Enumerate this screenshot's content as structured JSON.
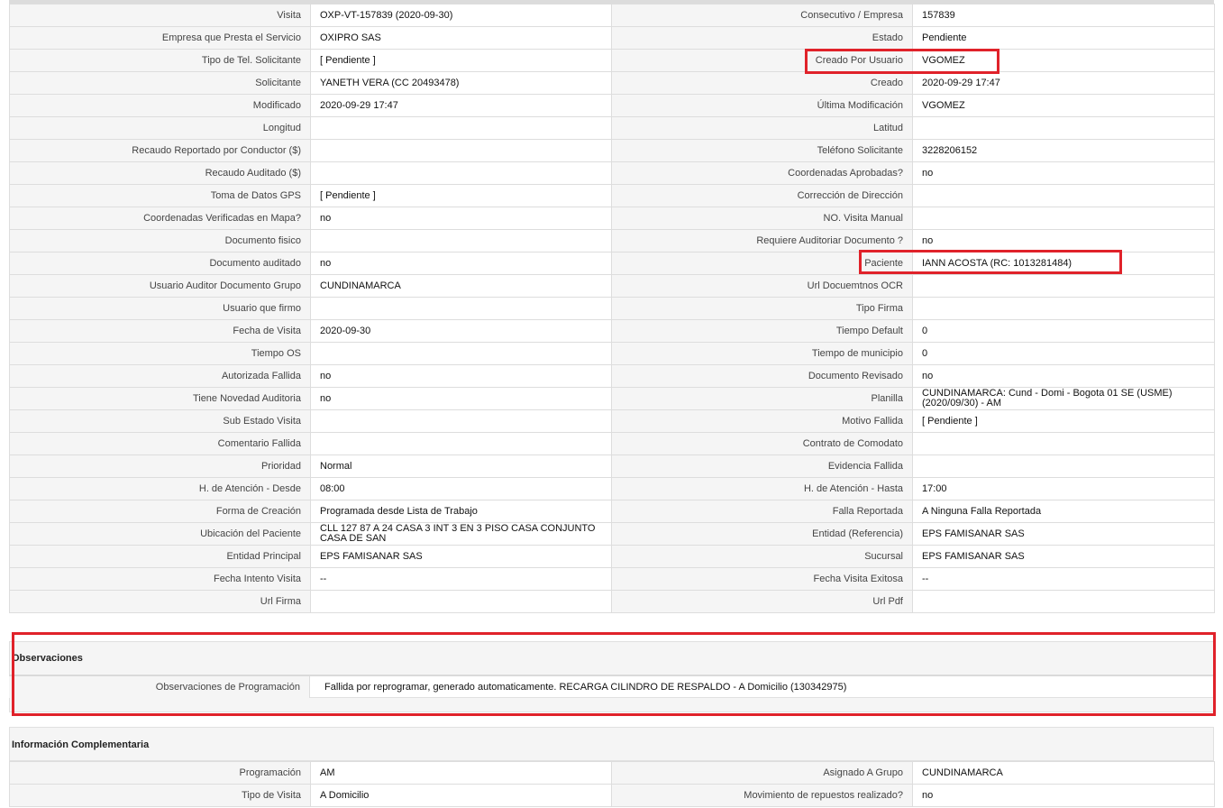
{
  "main_rows": [
    [
      {
        "l": "Visita",
        "v": "OXP-VT-157839 (2020-09-30)"
      },
      {
        "l": "Consecutivo / Empresa",
        "v": "157839"
      }
    ],
    [
      {
        "l": "Empresa que Presta el Servicio",
        "v": "OXIPRO SAS"
      },
      {
        "l": "Estado",
        "v": "Pendiente"
      }
    ],
    [
      {
        "l": "Tipo de Tel. Solicitante",
        "v": "[ Pendiente ]"
      },
      {
        "l": "Creado Por Usuario",
        "v": "VGOMEZ"
      }
    ],
    [
      {
        "l": "Solicitante",
        "v": "YANETH VERA (CC 20493478)"
      },
      {
        "l": "Creado",
        "v": "2020-09-29 17:47"
      }
    ],
    [
      {
        "l": "Modificado",
        "v": "2020-09-29 17:47"
      },
      {
        "l": "Última Modificación",
        "v": " VGOMEZ"
      }
    ],
    [
      {
        "l": "Longitud",
        "v": ""
      },
      {
        "l": "Latitud",
        "v": ""
      }
    ],
    [
      {
        "l": "Recaudo Reportado por Conductor ($)",
        "v": ""
      },
      {
        "l": "Teléfono Solicitante",
        "v": "3228206152"
      }
    ],
    [
      {
        "l": "Recaudo Auditado ($)",
        "v": ""
      },
      {
        "l": "Coordenadas Aprobadas?",
        "v": " no"
      }
    ],
    [
      {
        "l": "Toma de Datos GPS",
        "v": "[ Pendiente ]"
      },
      {
        "l": "Corrección de Dirección",
        "v": ""
      }
    ],
    [
      {
        "l": "Coordenadas Verificadas en Mapa?",
        "v": " no"
      },
      {
        "l": "NO. Visita Manual",
        "v": ""
      }
    ],
    [
      {
        "l": "Documento fisico",
        "v": ""
      },
      {
        "l": "Requiere Auditoriar Documento ?",
        "v": " no"
      }
    ],
    [
      {
        "l": "Documento auditado",
        "v": " no"
      },
      {
        "l": "Paciente",
        "v": "IANN ACOSTA (RC: 1013281484)"
      }
    ],
    [
      {
        "l": "Usuario Auditor Documento Grupo",
        "v": "CUNDINAMARCA"
      },
      {
        "l": "Url Docuemtnos OCR",
        "v": ""
      }
    ],
    [
      {
        "l": "Usuario que firmo",
        "v": ""
      },
      {
        "l": "Tipo Firma",
        "v": ""
      }
    ],
    [
      {
        "l": "Fecha de Visita",
        "v": " 2020-09-30"
      },
      {
        "l": "Tiempo Default",
        "v": " 0"
      }
    ],
    [
      {
        "l": "Tiempo OS",
        "v": ""
      },
      {
        "l": "Tiempo de municipio",
        "v": " 0"
      }
    ],
    [
      {
        "l": "Autorizada Fallida",
        "v": " no"
      },
      {
        "l": "Documento Revisado",
        "v": " no"
      }
    ],
    [
      {
        "l": "Tiene Novedad Auditoria",
        "v": " no"
      },
      {
        "l": "Planilla",
        "v": "CUNDINAMARCA: Cund - Domi - Bogota 01 SE (USME) (2020/09/30) - AM"
      }
    ],
    [
      {
        "l": "Sub Estado Visita",
        "v": ""
      },
      {
        "l": "Motivo Fallida",
        "v": "[ Pendiente ]"
      }
    ],
    [
      {
        "l": "Comentario Fallida",
        "v": ""
      },
      {
        "l": "Contrato de Comodato",
        "v": ""
      }
    ],
    [
      {
        "l": "Prioridad",
        "v": "Normal"
      },
      {
        "l": "Evidencia Fallida",
        "v": ""
      }
    ],
    [
      {
        "l": "H. de Atención - Desde",
        "v": "08:00"
      },
      {
        "l": "H. de Atención - Hasta",
        "v": "17:00"
      }
    ],
    [
      {
        "l": "Forma de Creación",
        "v": "Programada desde Lista de Trabajo"
      },
      {
        "l": "Falla Reportada",
        "v": "A Ninguna Falla Reportada"
      }
    ],
    [
      {
        "l": "Ubicación del Paciente",
        "v": "CLL 127 87 A 24 CASA 3 INT 3 EN 3 PISO CASA CONJUNTO CASA DE SAN"
      },
      {
        "l": "Entidad (Referencia)",
        "v": "EPS FAMISANAR SAS"
      }
    ],
    [
      {
        "l": "Entidad Principal",
        "v": "EPS FAMISANAR SAS"
      },
      {
        "l": "Sucursal",
        "v": "EPS FAMISANAR SAS"
      }
    ],
    [
      {
        "l": "Fecha Intento Visita",
        "v": " --"
      },
      {
        "l": "Fecha Visita Exitosa",
        "v": " --"
      }
    ],
    [
      {
        "l": "Url Firma",
        "v": ""
      },
      {
        "l": "Url Pdf",
        "v": ""
      }
    ]
  ],
  "observaciones": {
    "title": "Observaciones",
    "label": "Observaciones de Programación",
    "value": "Fallida por reprogramar, generado automaticamente. RECARGA CILINDRO DE RESPALDO - A Domicilio (130342975)"
  },
  "info": {
    "title": "Información Complementaria",
    "rows": [
      [
        {
          "l": "Programación",
          "v": "AM"
        },
        {
          "l": "Asignado A Grupo",
          "v": "CUNDINAMARCA"
        }
      ],
      [
        {
          "l": "Tipo de Visita",
          "v": "A Domicilio"
        },
        {
          "l": "Movimiento de repuestos realizado?",
          "v": " no"
        }
      ]
    ]
  },
  "colors": {
    "highlight": "#e0222a",
    "label_bg": "#f5f5f5",
    "border": "#dddddd"
  }
}
